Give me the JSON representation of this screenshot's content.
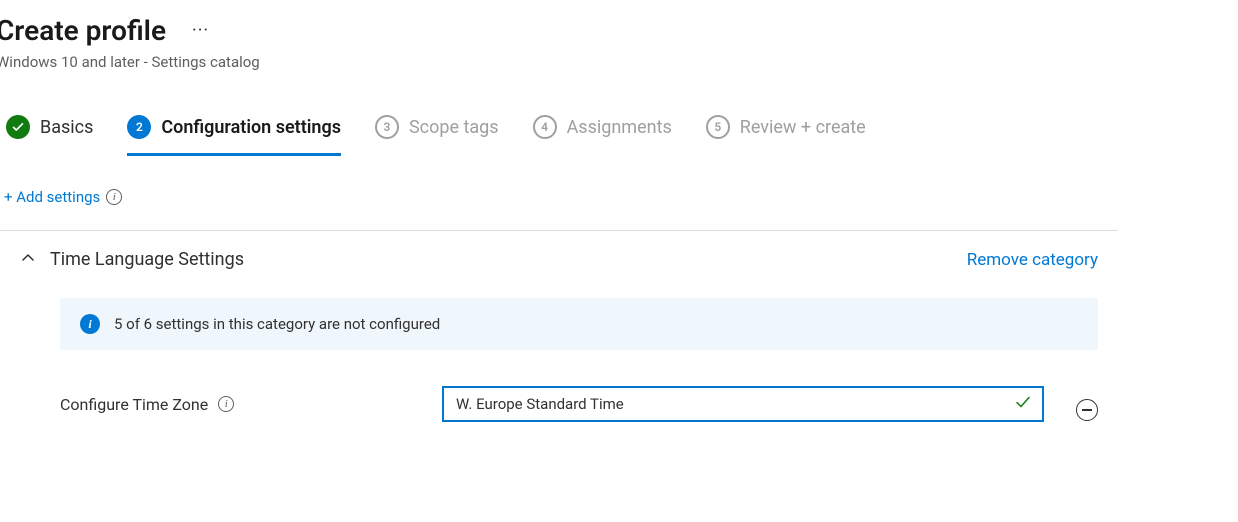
{
  "header": {
    "title": "Create profile",
    "subtitle": "Windows 10 and later - Settings catalog"
  },
  "wizard": {
    "steps": [
      {
        "num": "1",
        "label": "Basics",
        "state": "done"
      },
      {
        "num": "2",
        "label": "Configuration settings",
        "state": "active"
      },
      {
        "num": "3",
        "label": "Scope tags",
        "state": "pending"
      },
      {
        "num": "4",
        "label": "Assignments",
        "state": "pending"
      },
      {
        "num": "5",
        "label": "Review + create",
        "state": "pending"
      }
    ]
  },
  "actions": {
    "add_settings": "+ Add settings"
  },
  "category": {
    "title": "Time Language Settings",
    "remove_label": "Remove category",
    "banner_text": "5 of 6 settings in this category are not configured"
  },
  "setting": {
    "label": "Configure Time Zone",
    "value": "W. Europe Standard Time"
  }
}
